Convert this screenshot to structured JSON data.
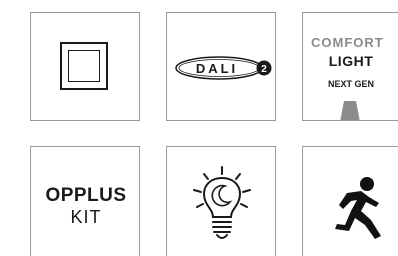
{
  "tiles": {
    "dali": {
      "text": "DALI",
      "badge": "2"
    },
    "comfort_light": {
      "line1": "COMFORT",
      "line2": "LIGHT",
      "line3": "NEXT GEN"
    },
    "opplus_kit": {
      "line1": "OPPLUS",
      "line2": "KIT"
    }
  },
  "colors": {
    "border": "#9a9a9a",
    "ink": "#1a1a1a",
    "grey_text": "#8b8b8b"
  },
  "icons": [
    "frame-icon",
    "dali2-logo-icon",
    "comfort-light-beam-icon",
    "lightbulb-moon-icon",
    "running-person-icon"
  ]
}
